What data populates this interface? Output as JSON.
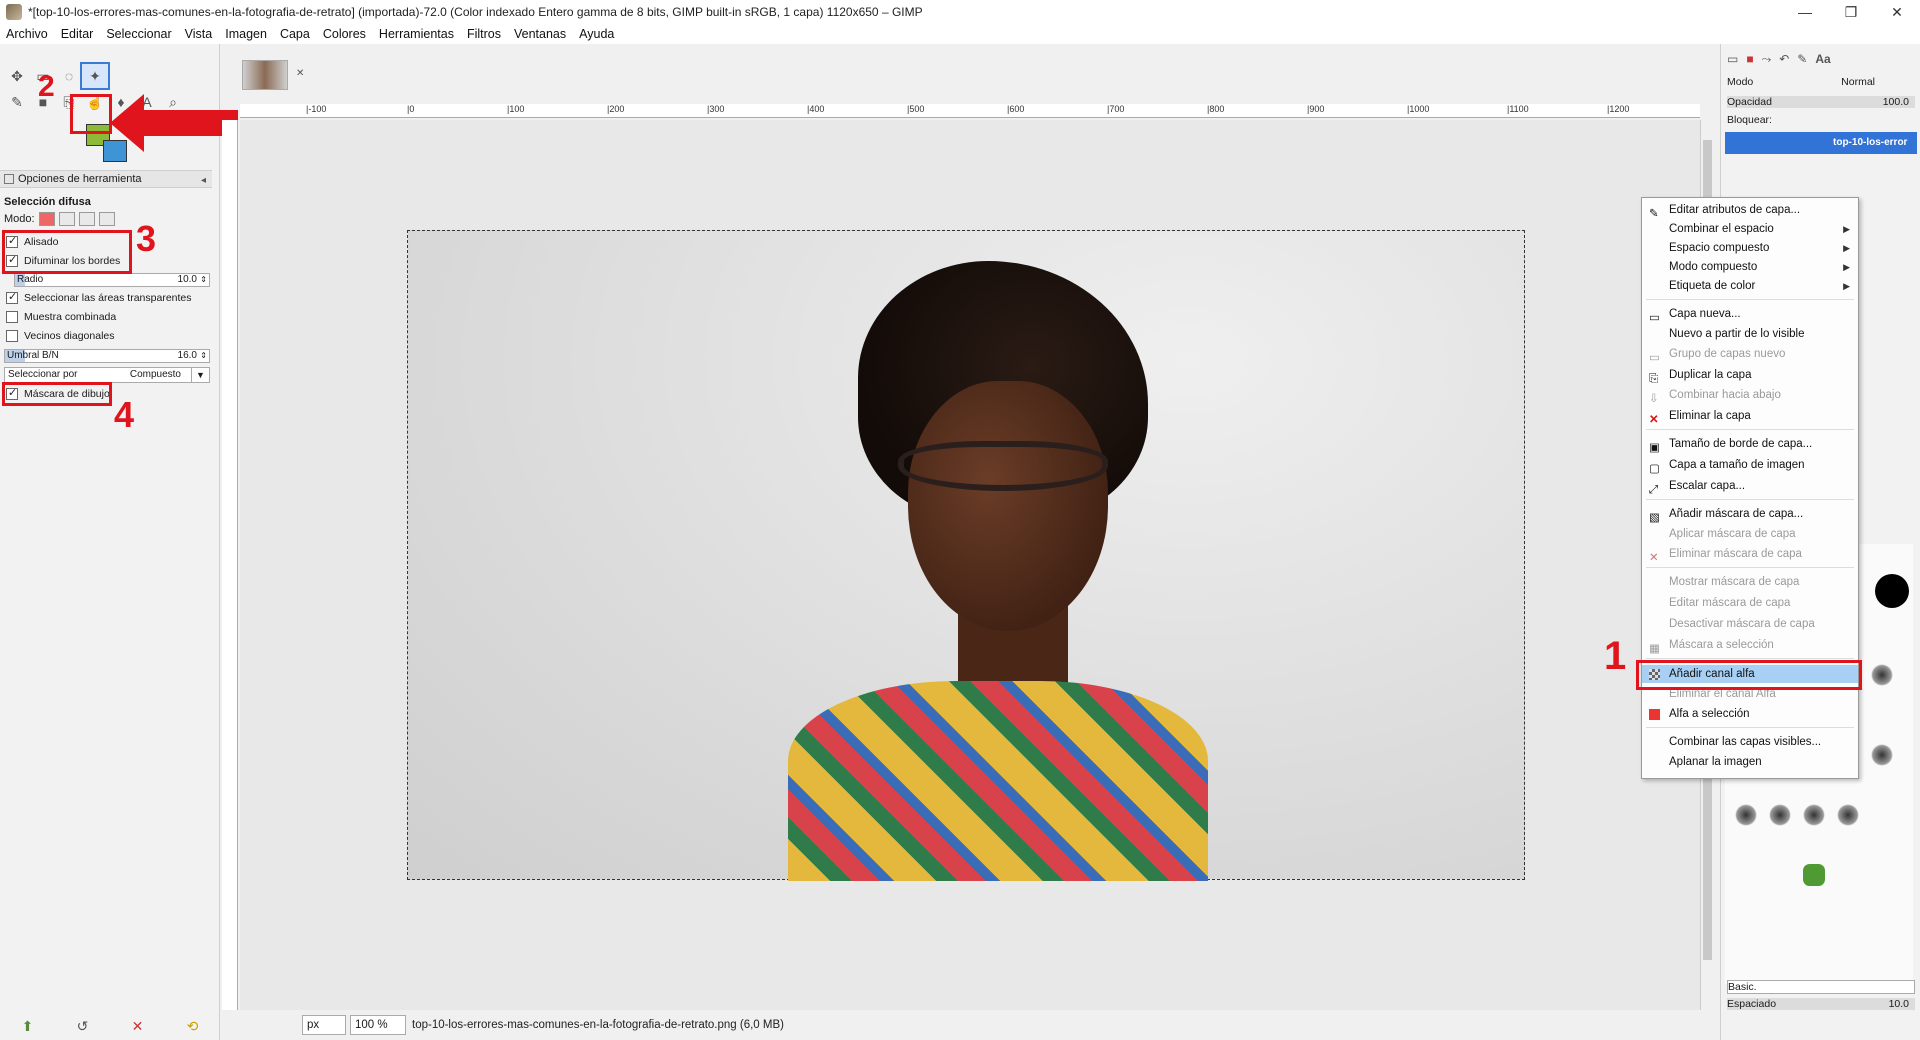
{
  "window": {
    "title": "*[top-10-los-errores-mas-comunes-en-la-fotografia-de-retrato] (importada)-72.0 (Color indexado Entero gamma de 8 bits, GIMP built-in sRGB, 1 capa) 1120x650 – GIMP",
    "minimize": "—",
    "maximize": "❐",
    "close": "✕"
  },
  "menubar": [
    "Archivo",
    "Editar",
    "Seleccionar",
    "Vista",
    "Imagen",
    "Capa",
    "Colores",
    "Herramientas",
    "Filtros",
    "Ventanas",
    "Ayuda"
  ],
  "tool_options": {
    "header": "Opciones de herramienta",
    "tool_name": "Selección difusa",
    "mode_label": "Modo:",
    "antialias": {
      "label": "Alisado",
      "checked": true
    },
    "feather": {
      "label": "Difuminar los bordes",
      "checked": true
    },
    "radius": {
      "label": "Radio",
      "value": "10.0"
    },
    "select_transparent": {
      "label": "Seleccionar las áreas transparentes",
      "checked": true
    },
    "sample_merged": {
      "label": "Muestra combinada",
      "checked": false
    },
    "diagonal": {
      "label": "Vecinos diagonales",
      "checked": false
    },
    "threshold": {
      "label": "Umbral B/N",
      "value": "16.0"
    },
    "select_by": {
      "label": "Seleccionar por",
      "value": "Compuesto"
    },
    "draw_mask": {
      "label": "Máscara de dibujo",
      "checked": true
    }
  },
  "annotations": {
    "one": "1",
    "two": "2",
    "three": "3",
    "four": "4"
  },
  "rulers": {
    "top": [
      "|-100",
      "|0",
      "|100",
      "|200",
      "|300",
      "|400",
      "|500",
      "|600",
      "|700",
      "|800",
      "|900",
      "|1000",
      "|1100",
      "|1200"
    ]
  },
  "statusbar": {
    "unit": "px",
    "zoom": "100 %",
    "file": "top-10-los-errores-mas-comunes-en-la-fotografia-de-retrato.png (6,0 MB)"
  },
  "dock": {
    "mode_label": "Modo",
    "mode_value": "Normal",
    "opacity_label": "Opacidad",
    "opacity_value": "100.0",
    "lock_label": "Bloquear:",
    "layer_name": "top-10-los-error",
    "brush_set": "Basic.",
    "spacing_label": "Espaciado",
    "spacing_value": "10.0"
  },
  "context_menu": [
    {
      "label": "Editar atributos de capa...",
      "disabled": false,
      "submenu": false
    },
    {
      "label": "Combinar el espacio",
      "disabled": false,
      "submenu": true
    },
    {
      "label": "Espacio compuesto",
      "disabled": false,
      "submenu": true
    },
    {
      "label": "Modo compuesto",
      "disabled": false,
      "submenu": true
    },
    {
      "label": "Etiqueta de color",
      "disabled": false,
      "submenu": true
    },
    {
      "label": "Capa nueva...",
      "disabled": false,
      "submenu": false
    },
    {
      "label": "Nuevo a partir de lo visible",
      "disabled": false,
      "submenu": false
    },
    {
      "label": "Grupo de capas nuevo",
      "disabled": true,
      "submenu": false
    },
    {
      "label": "Duplicar la capa",
      "disabled": false,
      "submenu": false
    },
    {
      "label": "Combinar hacia abajo",
      "disabled": true,
      "submenu": false
    },
    {
      "label": "Eliminar la capa",
      "disabled": false,
      "submenu": false
    },
    {
      "label": "Tamaño de borde de capa...",
      "disabled": false,
      "submenu": false
    },
    {
      "label": "Capa a tamaño de imagen",
      "disabled": false,
      "submenu": false
    },
    {
      "label": "Escalar capa...",
      "disabled": false,
      "submenu": false
    },
    {
      "label": "Añadir máscara de capa...",
      "disabled": false,
      "submenu": false
    },
    {
      "label": "Aplicar máscara de capa",
      "disabled": true,
      "submenu": false
    },
    {
      "label": "Eliminar máscara de capa",
      "disabled": true,
      "submenu": false
    },
    {
      "label": "Mostrar máscara de capa",
      "disabled": true,
      "submenu": false
    },
    {
      "label": "Editar máscara de capa",
      "disabled": true,
      "submenu": false
    },
    {
      "label": "Desactivar máscara de capa",
      "disabled": true,
      "submenu": false
    },
    {
      "label": "Máscara a selección",
      "disabled": true,
      "submenu": false
    },
    {
      "label": "Añadir canal alfa",
      "disabled": false,
      "submenu": false,
      "highlighted": true
    },
    {
      "label": "Eliminar el canal Alfa",
      "disabled": true,
      "submenu": false
    },
    {
      "label": "Alfa a selección",
      "disabled": false,
      "submenu": false
    },
    {
      "label": "Combinar las capas visibles...",
      "disabled": false,
      "submenu": false
    },
    {
      "label": "Aplanar la imagen",
      "disabled": false,
      "submenu": false
    }
  ],
  "colors": {
    "accent": "#3173d6",
    "annotation": "#e0141c",
    "highlight": "#a8d0f5",
    "foreground_color": "#8dbb37",
    "background_color": "#3f94d6"
  }
}
